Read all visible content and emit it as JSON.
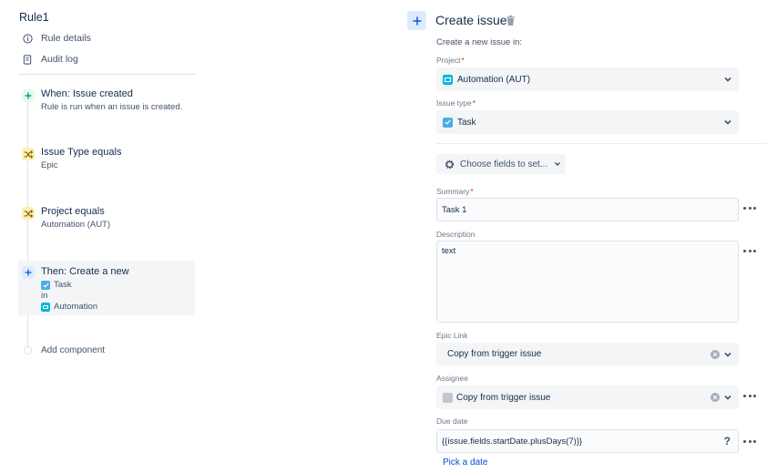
{
  "rule": {
    "title": "Rule1",
    "nav": [
      {
        "label": "Rule details",
        "icon": "info-icon"
      },
      {
        "label": "Audit log",
        "icon": "document-icon"
      }
    ],
    "steps": [
      {
        "title": "When: Issue created",
        "subtitle": "Rule is run when an issue is created.",
        "icon": "plus-icon",
        "color": "#00875a"
      },
      {
        "title": "Issue Type equals",
        "subtitle": "Epic",
        "icon": "shuffle-icon",
        "color": "#7a5b00"
      },
      {
        "title": "Project equals",
        "subtitle": "Automation (AUT)",
        "icon": "shuffle-icon",
        "color": "#7a5b00"
      },
      {
        "title": "Then: Create a new",
        "issue_type": "Task",
        "connector": "in",
        "project": "Automation",
        "icon": "plus-icon",
        "color": "#0052cc"
      }
    ],
    "add_component": "Add component"
  },
  "panel": {
    "title": "Create issue",
    "subtitle": "Create a new issue in:",
    "project": {
      "label": "Project",
      "value": "Automation (AUT)"
    },
    "issue_type": {
      "label": "Issue type",
      "value": "Task"
    },
    "choose_fields": "Choose fields to set...",
    "summary": {
      "label": "Summary",
      "value": "Task 1"
    },
    "description": {
      "label": "Description",
      "value": "text"
    },
    "epic_link": {
      "label": "Epic Link",
      "value": "Copy from trigger issue"
    },
    "assignee": {
      "label": "Assignee",
      "value": "Copy from trigger issue"
    },
    "due_date": {
      "label": "Due date",
      "value": "{{issue.fields.startDate.plusDays(7)}}",
      "help": "?"
    },
    "pick_date": "Pick a date",
    "required_mark": "*"
  }
}
